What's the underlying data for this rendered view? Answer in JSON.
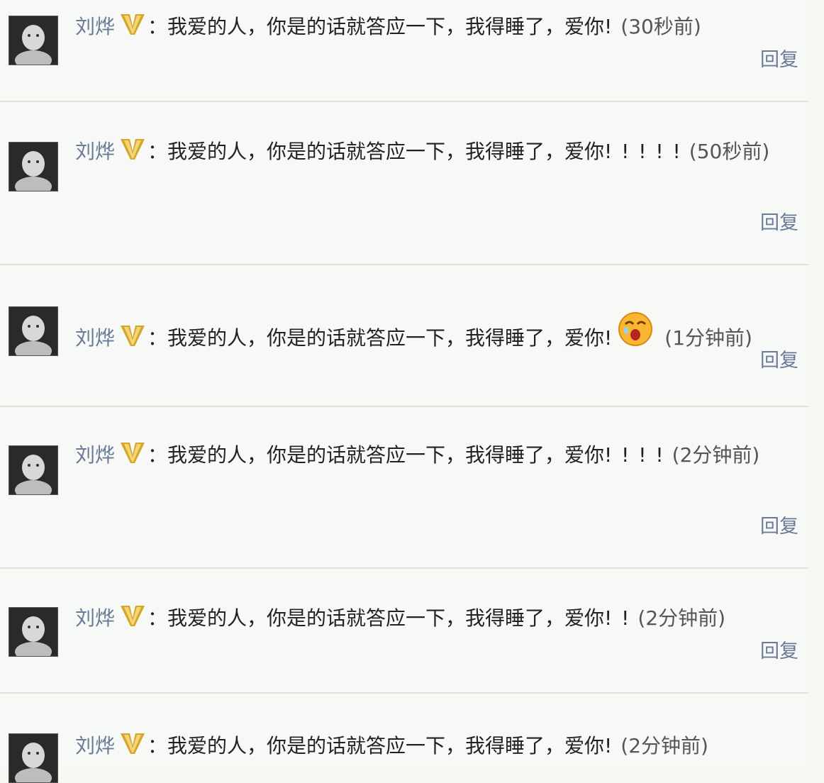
{
  "comments": [
    {
      "username": "刘烨",
      "separator": "：",
      "message": "我爱的人，你是的话就答应一下，我得睡了，爱你",
      "exclaim": "!",
      "emoji": "",
      "time": "(30秒前)",
      "reply": "回复"
    },
    {
      "username": "刘烨",
      "separator": "：",
      "message": "我爱的人，你是的话就答应一下，我得睡了，爱你",
      "exclaim": "! ! ! ! !",
      "emoji": "",
      "time": "(50秒前)",
      "reply": "回复"
    },
    {
      "username": "刘烨",
      "separator": "：",
      "message": "我爱的人，你是的话就答应一下，我得睡了，爱你",
      "exclaim": "!",
      "emoji": "crying-face-emoji",
      "time": "(1分钟前)",
      "reply": "回复"
    },
    {
      "username": "刘烨",
      "separator": "：",
      "message": "我爱的人，你是的话就答应一下，我得睡了，爱你",
      "exclaim": "! ! ! !",
      "emoji": "",
      "time": "(2分钟前)",
      "reply": "回复"
    },
    {
      "username": "刘烨",
      "separator": "：",
      "message": "我爱的人，你是的话就答应一下，我得睡了，爱你",
      "exclaim": "! !",
      "emoji": "",
      "time": "(2分钟前)",
      "reply": "回复"
    },
    {
      "username": "刘烨",
      "separator": "：",
      "message": "我爱的人，你是的话就答应一下，我得睡了，爱你",
      "exclaim": "!",
      "emoji": "",
      "time": "(2分钟前)",
      "reply": ""
    }
  ],
  "badge_icon": "verified-v-icon",
  "colors": {
    "username": "#6a7a98",
    "reply": "#6a7a98",
    "badge": "#d4a72c",
    "divider": "#dde2da"
  }
}
